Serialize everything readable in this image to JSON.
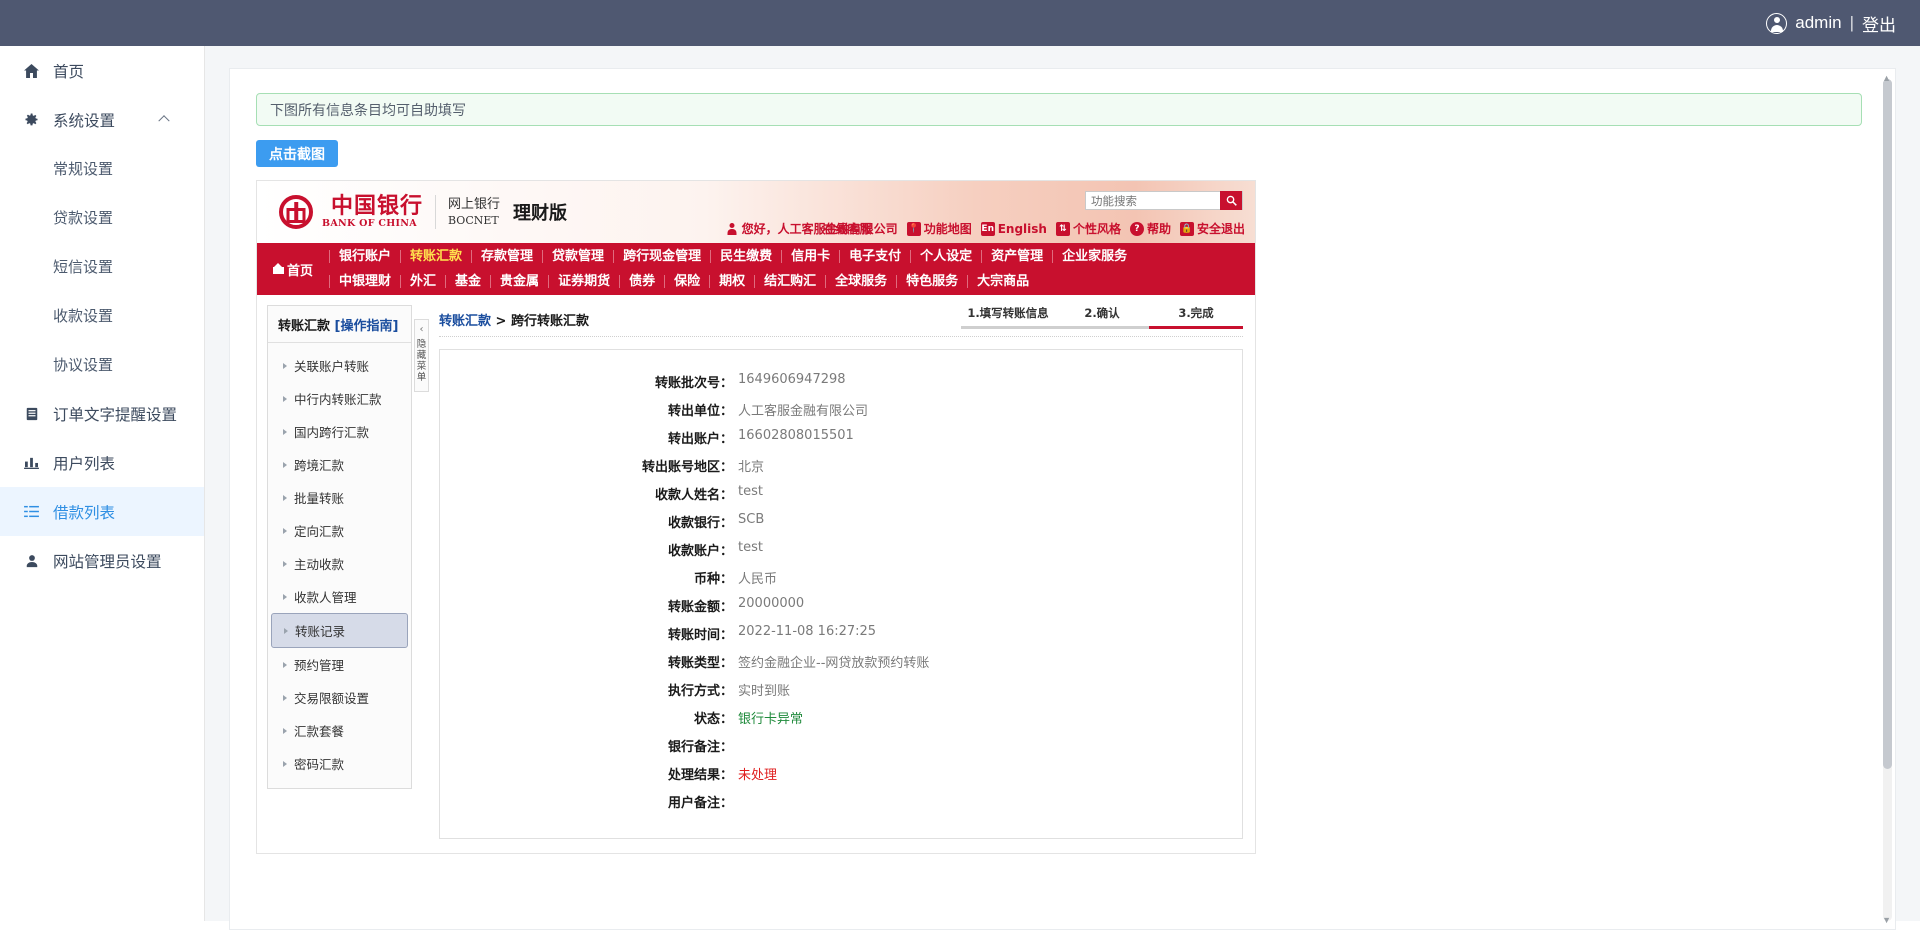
{
  "topbar": {
    "user": "admin",
    "separator": "|",
    "logout": "登出",
    "avatar_icon": "user-avatar-icon"
  },
  "sidebar": {
    "items": [
      {
        "label": "首页",
        "icon": "home-icon",
        "type": "top",
        "active": false
      },
      {
        "label": "系统设置",
        "icon": "gear-icon",
        "type": "top",
        "active": false,
        "expanded": true
      },
      {
        "label": "常规设置",
        "icon": "",
        "type": "sub",
        "active": false
      },
      {
        "label": "贷款设置",
        "icon": "",
        "type": "sub",
        "active": false
      },
      {
        "label": "短信设置",
        "icon": "",
        "type": "sub",
        "active": false
      },
      {
        "label": "收款设置",
        "icon": "",
        "type": "sub",
        "active": false
      },
      {
        "label": "协议设置",
        "icon": "",
        "type": "sub",
        "active": false
      },
      {
        "label": "订单文字提醒设置",
        "icon": "document-icon",
        "type": "top",
        "active": false
      },
      {
        "label": "用户列表",
        "icon": "chart-icon",
        "type": "top",
        "active": false
      },
      {
        "label": "借款列表",
        "icon": "list-icon",
        "type": "top",
        "active": true
      },
      {
        "label": "网站管理员设置",
        "icon": "person-icon",
        "type": "top",
        "active": false
      }
    ]
  },
  "main": {
    "alert": "下图所有信息条目均可自助填写",
    "capture_button": "点击截图"
  },
  "bank": {
    "brand_cn": "中国银行",
    "brand_en": "BANK OF CHINA",
    "sub_cn": "网上银行",
    "sub_en": "BOCNET",
    "edition": "理财版",
    "search_placeholder": "功能搜索",
    "search_value": "",
    "search_icon": "search-icon",
    "greeting": "您好，人工客服金融有限公司",
    "greeting_overlay": "在线客服",
    "utilities": [
      {
        "label": "功能地图",
        "icon": "map-pin-icon"
      },
      {
        "label": "English",
        "icon": "en-icon"
      },
      {
        "label": "个性风格",
        "icon": "style-icon"
      },
      {
        "label": "帮助",
        "icon": "help-icon"
      },
      {
        "label": "安全退出",
        "icon": "lock-icon"
      }
    ],
    "nav_home": "首页",
    "nav_row1": [
      {
        "label": "银行账户",
        "current": false
      },
      {
        "label": "转账汇款",
        "current": true
      },
      {
        "label": "存款管理",
        "current": false
      },
      {
        "label": "贷款管理",
        "current": false
      },
      {
        "label": "跨行现金管理",
        "current": false
      },
      {
        "label": "民生缴费",
        "current": false
      },
      {
        "label": "信用卡",
        "current": false
      },
      {
        "label": "电子支付",
        "current": false
      },
      {
        "label": "个人设定",
        "current": false
      },
      {
        "label": "资产管理",
        "current": false
      },
      {
        "label": "企业家服务",
        "current": false
      }
    ],
    "nav_row2": [
      {
        "label": "中银理财",
        "current": false
      },
      {
        "label": "外汇",
        "current": false
      },
      {
        "label": "基金",
        "current": false
      },
      {
        "label": "贵金属",
        "current": false
      },
      {
        "label": "证券期货",
        "current": false
      },
      {
        "label": "债券",
        "current": false
      },
      {
        "label": "保险",
        "current": false
      },
      {
        "label": "期权",
        "current": false
      },
      {
        "label": "结汇购汇",
        "current": false
      },
      {
        "label": "全球服务",
        "current": false
      },
      {
        "label": "特色服务",
        "current": false
      },
      {
        "label": "大宗商品",
        "current": false
      }
    ],
    "left_panel": {
      "title": "转账汇款",
      "guide": "[操作指南]",
      "items": [
        {
          "label": "关联账户转账",
          "selected": false
        },
        {
          "label": "中行内转账汇款",
          "selected": false
        },
        {
          "label": "国内跨行汇款",
          "selected": false
        },
        {
          "label": "跨境汇款",
          "selected": false
        },
        {
          "label": "批量转账",
          "selected": false
        },
        {
          "label": "定向汇款",
          "selected": false
        },
        {
          "label": "主动收款",
          "selected": false
        },
        {
          "label": "收款人管理",
          "selected": false
        },
        {
          "label": "转账记录",
          "selected": true
        },
        {
          "label": "预约管理",
          "selected": false
        },
        {
          "label": "交易限额设置",
          "selected": false
        },
        {
          "label": "汇款套餐",
          "selected": false
        },
        {
          "label": "密码汇款",
          "selected": false
        }
      ],
      "collapse_label": "隐藏菜单",
      "collapse_icon": "chevron-left-icon"
    },
    "breadcrumb_1": "转账汇款",
    "breadcrumb_sep": ">",
    "breadcrumb_2": "跨行转账汇款",
    "steps": [
      {
        "label": "1.填写转账信息",
        "done": false
      },
      {
        "label": "2.确认",
        "done": false
      },
      {
        "label": "3.完成",
        "done": true
      }
    ],
    "details": [
      {
        "label": "转账批次号：",
        "value": "1649606947298",
        "style": ""
      },
      {
        "label": "转出单位：",
        "value": "人工客服金融有限公司",
        "style": ""
      },
      {
        "label": "转出账户：",
        "value": "16602808015501",
        "style": ""
      },
      {
        "label": "转出账号地区：",
        "value": "北京",
        "style": ""
      },
      {
        "label": "收款人姓名：",
        "value": "test",
        "style": ""
      },
      {
        "label": "收款银行：",
        "value": "SCB",
        "style": ""
      },
      {
        "label": "收款账户：",
        "value": "test",
        "style": ""
      },
      {
        "label": "币种：",
        "value": "人民币",
        "style": ""
      },
      {
        "label": "转账金额：",
        "value": "20000000",
        "style": ""
      },
      {
        "label": "转账时间：",
        "value": "2022-11-08 16:27:25",
        "style": ""
      },
      {
        "label": "转账类型：",
        "value": "签约金融企业--网贷放款预约转账",
        "style": ""
      },
      {
        "label": "执行方式：",
        "value": "实时到账",
        "style": ""
      },
      {
        "label": "状态：",
        "value": "银行卡异常",
        "style": "green"
      },
      {
        "label": "银行备注：",
        "value": "",
        "style": ""
      },
      {
        "label": "处理结果：",
        "value": "未处理",
        "style": "red"
      },
      {
        "label": "用户备注：",
        "value": "",
        "style": ""
      }
    ]
  },
  "colors": {
    "topbar": "#4f5871",
    "accent_blue": "#3c9cf0",
    "boc_red": "#c8102e",
    "status_green": "#1f8a3b",
    "status_red": "#e02020"
  }
}
